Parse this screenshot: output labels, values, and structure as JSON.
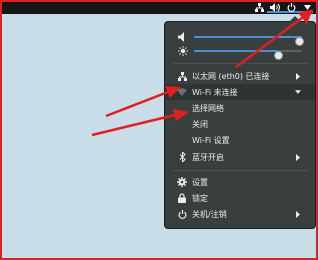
{
  "colors": {
    "desktop": "#c9dde9",
    "panel": "#393f3f",
    "accent": "#4a90d9",
    "annotation_red": "#e02020"
  },
  "top_bar": {
    "icons": [
      "network-wired-icon",
      "volume-icon",
      "power-icon",
      "chevron-down-icon"
    ]
  },
  "sliders": [
    {
      "icon": "volume-icon",
      "level": 0.99
    },
    {
      "icon": "brightness-icon",
      "level": 0.78
    }
  ],
  "menu": {
    "ethernet_label": "以太网 (eth0) 已连接",
    "wifi_label": "Wi-Fi 未连接",
    "wifi_submenu": [
      "选择网络",
      "关闭",
      "Wi-Fi 设置"
    ],
    "bluetooth_label": "蓝牙开启",
    "settings_label": "设置",
    "lock_label": "锁定",
    "power_label": "关机/注销"
  }
}
